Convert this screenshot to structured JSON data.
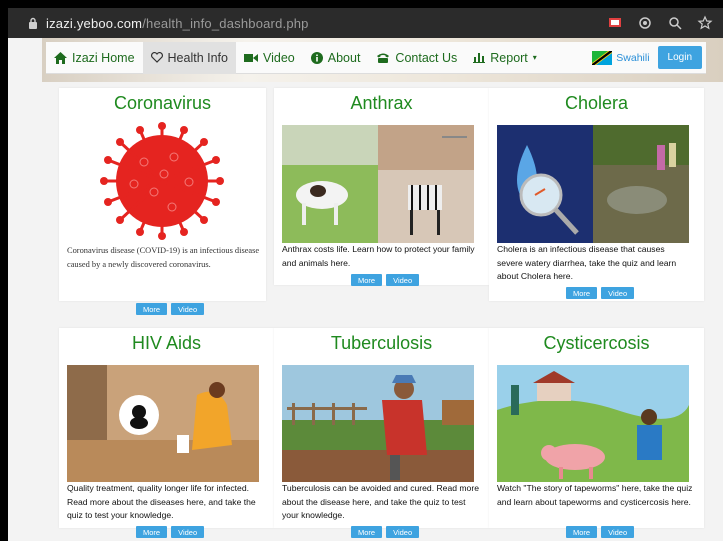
{
  "browser": {
    "url_host": "izazi.yeboo.com",
    "url_path": "/health_info_dashboard.php"
  },
  "nav": {
    "items": [
      {
        "label": "Izazi Home",
        "icon": "home-icon"
      },
      {
        "label": "Health Info",
        "icon": "heart-icon"
      },
      {
        "label": "Video",
        "icon": "video-icon"
      },
      {
        "label": "About",
        "icon": "info-icon"
      },
      {
        "label": "Contact Us",
        "icon": "phone-icon"
      },
      {
        "label": "Report",
        "icon": "bar-chart-icon"
      }
    ],
    "language": "Swahili",
    "login": "Login"
  },
  "cards": [
    {
      "title": "Coronavirus",
      "desc": "Coronavirus disease (COVID-19) is an infectious disease caused by a newly discovered coronavirus.",
      "more": "More",
      "video": "Video"
    },
    {
      "title": "Anthrax",
      "desc": "Anthrax costs life. Learn how to protect your family and animals here.",
      "more": "More",
      "video": "Video"
    },
    {
      "title": "Cholera",
      "desc": "Cholera is an infectious disease that causes severe watery diarrhea, take the quiz and learn about Cholera here.",
      "more": "More",
      "video": "Video"
    },
    {
      "title": "HIV Aids",
      "desc": "Quality treatment, quality longer life for infected. Read more about the diseases here, and take the quiz to test your knowledge.",
      "more": "More",
      "video": "Video"
    },
    {
      "title": "Tuberculosis",
      "desc": "Tuberculosis can be avoided and cured. Read more about the disease here, and take the quiz to test your knowledge.",
      "more": "More",
      "video": "Video"
    },
    {
      "title": "Cysticercosis",
      "desc": "Watch \"The story of tapeworms\" here, take the quiz and learn about tapeworms and cysticercosis here.",
      "more": "More",
      "video": "Video"
    }
  ],
  "colors": {
    "title_green": "#1f8a1f",
    "button_blue": "#3ea3e0",
    "nav_green": "#1e6b1e"
  }
}
